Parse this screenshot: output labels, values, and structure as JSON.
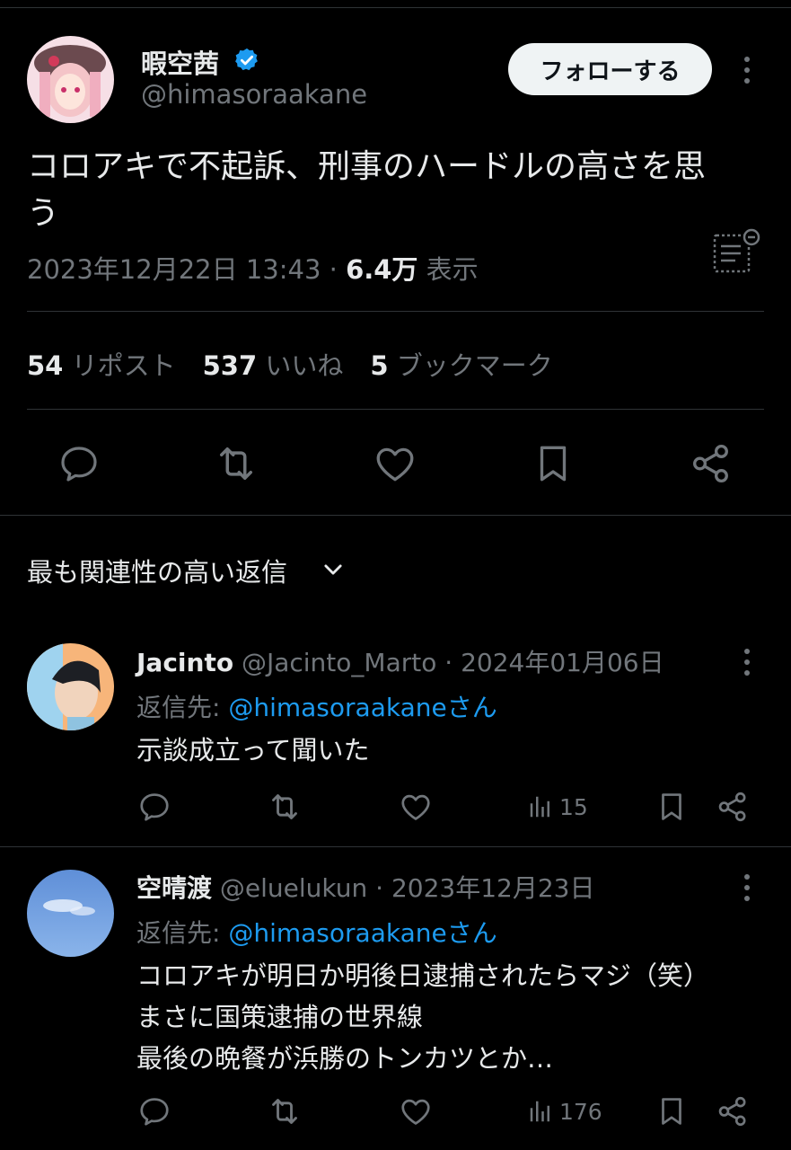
{
  "tweet": {
    "author_name": "暇空茜",
    "author_handle": "@himasoraakane",
    "follow_label": "フォローする",
    "text_line1": "コロアキで不起訴、刑事のハードルの高さを思",
    "text_line2": "う",
    "timestamp": "2023年12月22日 13:43",
    "separator": " · ",
    "views_count": "6.4万",
    "views_label": "表示",
    "stats": {
      "reposts_count": "54",
      "reposts_label": "リポスト",
      "likes_count": "537",
      "likes_label": "いいね",
      "bookmarks_count": "5",
      "bookmarks_label": "ブックマーク"
    }
  },
  "replies_sort": {
    "label": "最も関連性の高い返信"
  },
  "replies": [
    {
      "name": "Jacinto",
      "handle": "@Jacinto_Marto",
      "separator": " · ",
      "date": "2024年01月06日",
      "reply_prefix": "返信先: ",
      "reply_to": "@himasoraakaneさん",
      "text_lines": [
        "示談成立って聞いた"
      ],
      "views": "15"
    },
    {
      "name": "空晴渡",
      "handle": "@eluelukun",
      "separator": " · ",
      "date": "2023年12月23日",
      "reply_prefix": "返信先: ",
      "reply_to": "@himasoraakaneさん",
      "text_lines": [
        "コロアキが明日か明後日逮捕されたらマジ（笑）",
        "まさに国策逮捕の世界線",
        "最後の晩餐が浜勝のトンカツとか…"
      ],
      "views": "176"
    }
  ],
  "colors": {
    "background": "#000000",
    "text_primary": "#e7e9ea",
    "text_secondary": "#71767b",
    "accent": "#1d9bf0",
    "divider": "#2f3336"
  },
  "icons": [
    "verified-badge-icon",
    "more-icon",
    "analytics-icon",
    "reply-icon",
    "repost-icon",
    "like-icon",
    "bookmark-icon",
    "share-icon",
    "views-icon",
    "chevron-down-icon"
  ]
}
